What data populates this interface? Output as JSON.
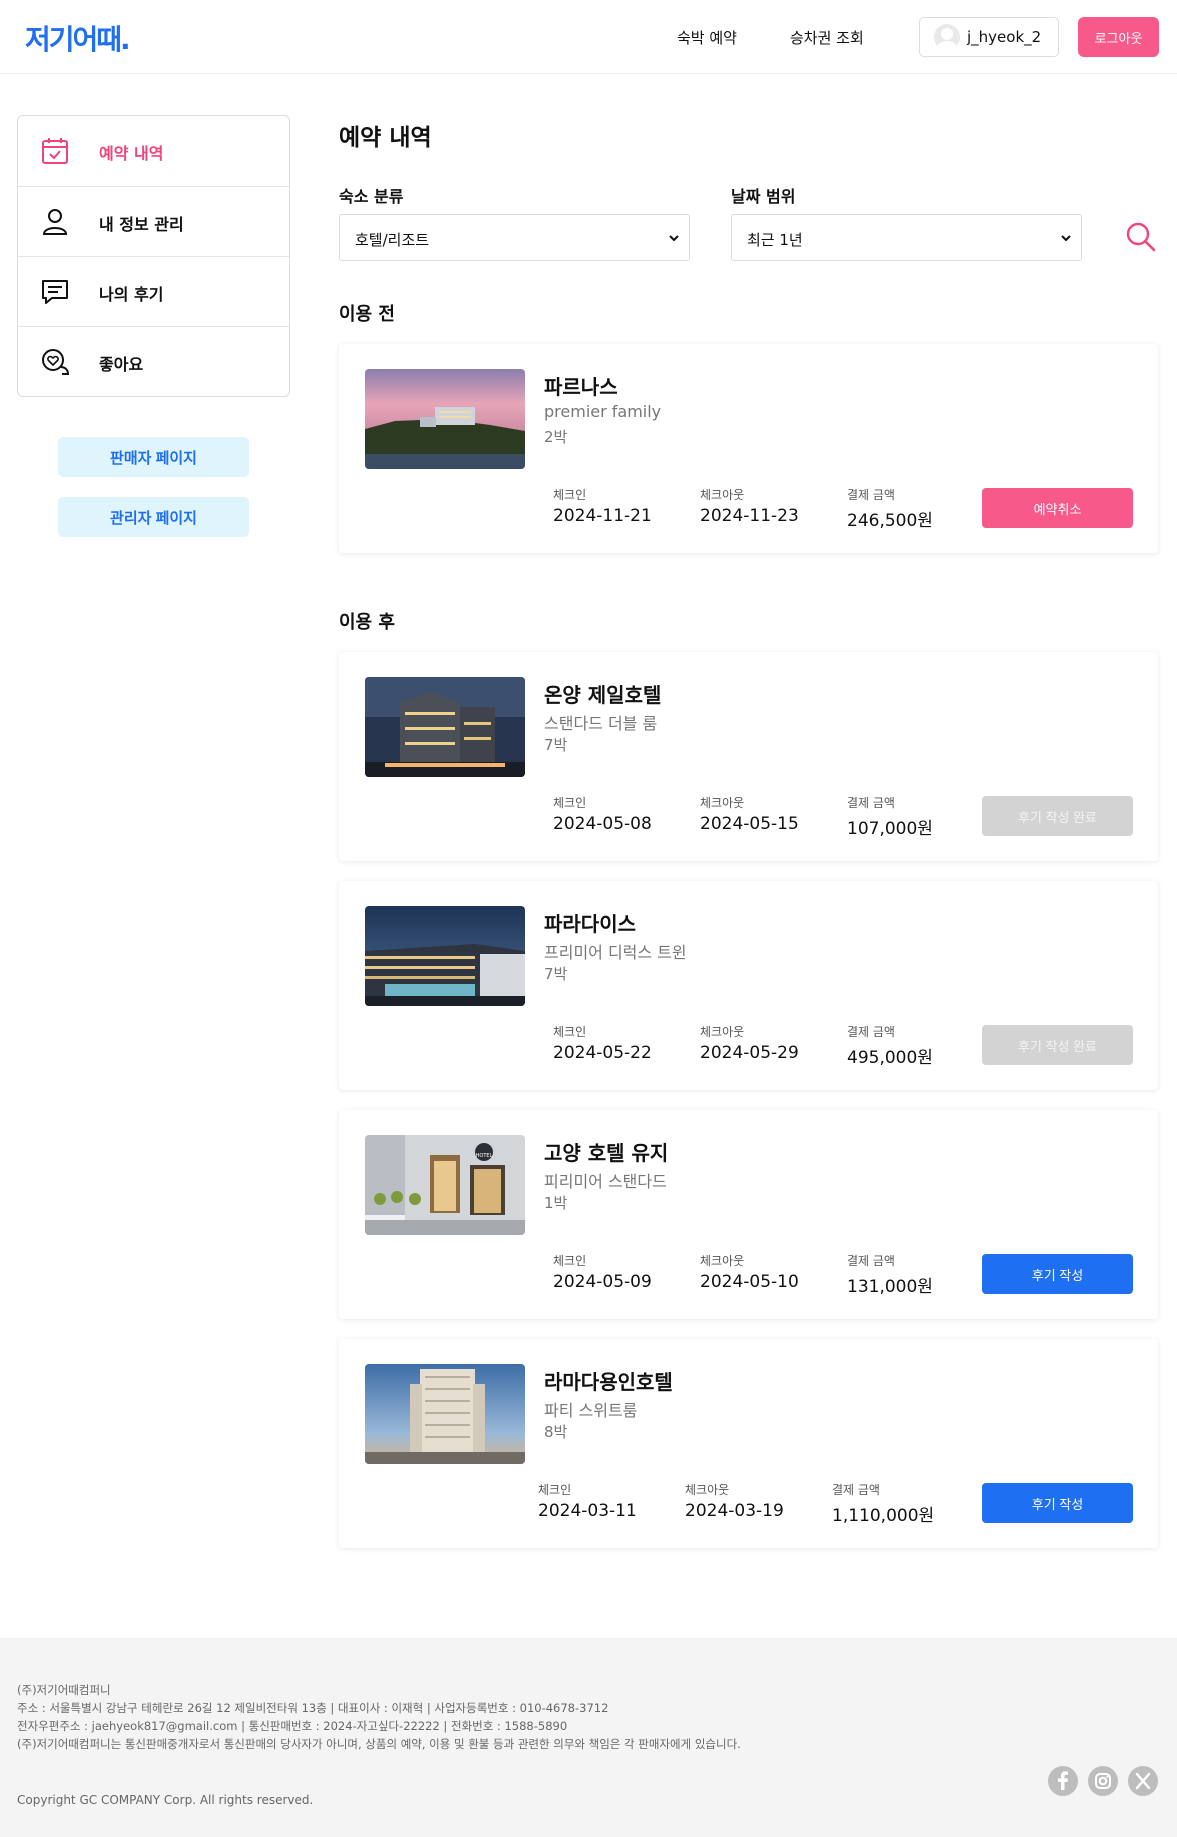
{
  "header": {
    "logo": "저기어때.",
    "nav": {
      "stay": "숙박 예약",
      "ticket": "승차권 조회"
    },
    "username": "j_hyeok_2",
    "logout": "로그아웃"
  },
  "sidebar": {
    "items": [
      {
        "label": "예약 내역",
        "icon": "calendar-check-icon",
        "active": true
      },
      {
        "label": "내 정보 관리",
        "icon": "user-icon"
      },
      {
        "label": "나의 후기",
        "icon": "chat-icon"
      },
      {
        "label": "좋아요",
        "icon": "heart-chat-icon"
      }
    ],
    "seller_page": "판매자 페이지",
    "admin_page": "관리자 페이지"
  },
  "main": {
    "title": "예약 내역",
    "filters": {
      "category_label": "숙소 분류",
      "category_value": "호텔/리조트",
      "range_label": "날짜 범위",
      "range_value": "최근 1년"
    },
    "labels": {
      "checkin": "체크인",
      "checkout": "체크아웃",
      "amount": "결제 금액"
    },
    "before": {
      "title": "이용 전",
      "items": [
        {
          "name": "파르나스",
          "room": "premier family",
          "nights": "2박",
          "checkin": "2024-11-21",
          "checkout": "2024-11-23",
          "amount": "246,500원",
          "button": "예약취소"
        }
      ]
    },
    "after": {
      "title": "이용 후",
      "items": [
        {
          "name": "온양 제일호텔",
          "room": "스탠다드 더블 룸",
          "nights": "7박",
          "checkin": "2024-05-08",
          "checkout": "2024-05-15",
          "amount": "107,000원",
          "button": "후기 작성 완료"
        },
        {
          "name": "파라다이스",
          "room": "프리미어 디럭스 트윈",
          "nights": "7박",
          "checkin": "2024-05-22",
          "checkout": "2024-05-29",
          "amount": "495,000원",
          "button": "후기 작성 완료"
        },
        {
          "name": "고양 호텔 유지",
          "room": "피리미어 스탠다드",
          "nights": "1박",
          "checkin": "2024-05-09",
          "checkout": "2024-05-10",
          "amount": "131,000원",
          "button": "후기 작성",
          "sign": "HOTEL"
        },
        {
          "name": "라마다용인호텔",
          "room": "파티 스위트룸",
          "nights": "8박",
          "checkin": "2024-03-11",
          "checkout": "2024-03-19",
          "amount": "1,110,000원",
          "button": "후기 작성"
        }
      ]
    }
  },
  "footer": {
    "company": "(주)저기어때컴퍼니",
    "address": "주소 : 서울특별시 강남구 테헤란로 26길 12 제일비전타워 13층 | 대표이사 : 이재혁 | 사업자등록번호 : 010-4678-3712",
    "contact": "전자우편주소 : jaehyeok817@gmail.com | 통신판매번호 : 2024-자고싶다-22222 | 전화번호 : 1588-5890",
    "notice": "(주)저기어때컴퍼니는 통신판매중개자로서 통신판매의 당사자가 아니며, 상품의 예약, 이용 및 환불 등과 관련한 의무와 책임은 각 판매자에게 있습니다.",
    "copyright": "Copyright GC COMPANY Corp. All rights reserved."
  },
  "colors": {
    "brand_blue": "#1e6ff1",
    "accent_pink": "#f75a8a",
    "active_pink": "#f0457a",
    "disabled_gray": "#d3d3d3",
    "light_blue_bg": "#dff4fb"
  }
}
